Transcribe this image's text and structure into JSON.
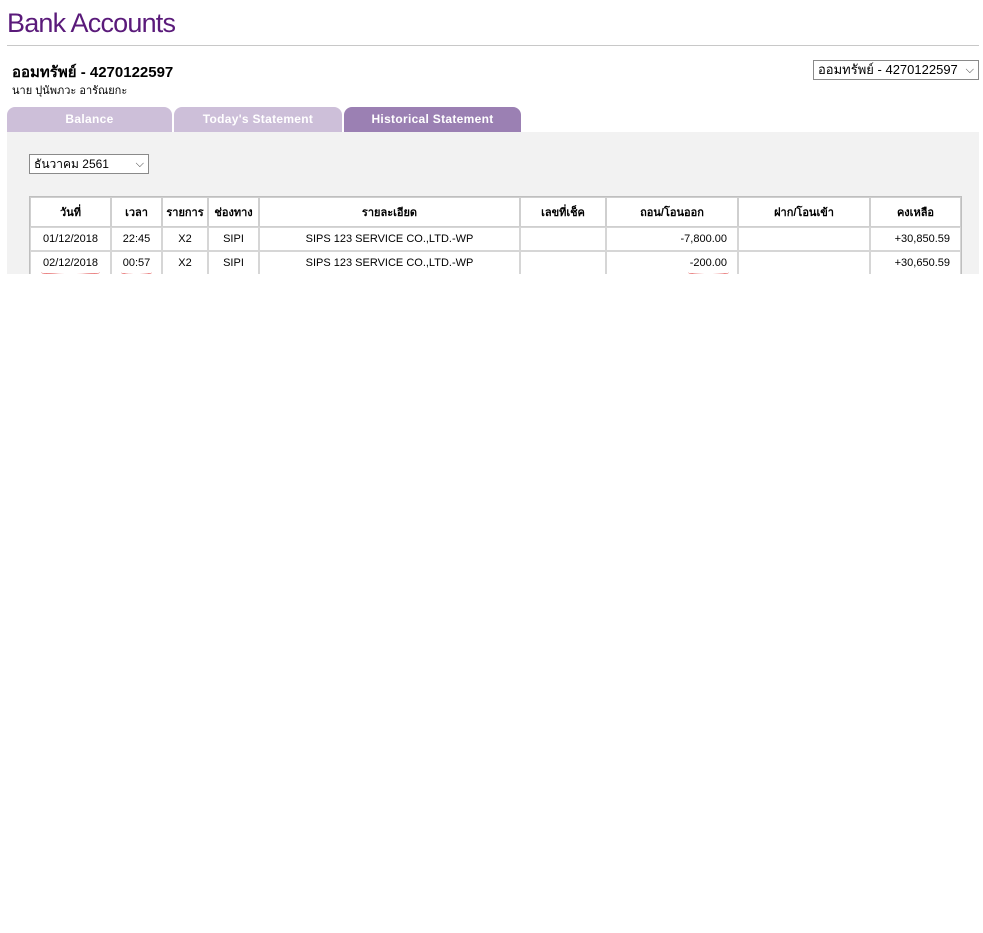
{
  "page": {
    "title": "Bank Accounts"
  },
  "account": {
    "name": "ออมทรัพย์ - 4270122597",
    "owner": "นาย ปุนัพภวะ อารัณยกะ",
    "selector_value": "ออมทรัพย์ - 4270122597"
  },
  "tabs": [
    {
      "label": "Balance"
    },
    {
      "label": "Today's Statement"
    },
    {
      "label": "Historical Statement"
    }
  ],
  "filters": {
    "month_value": "ธันวาคม 2561"
  },
  "statement": {
    "headers": [
      "วันที่",
      "เวลา",
      "รายการ",
      "ช่องทาง",
      "รายละเอียด",
      "เลขที่เช็ค",
      "ถอน/โอนออก",
      "ฝาก/โอนเข้า",
      "คงเหลือ"
    ],
    "rows": [
      {
        "date": "01/12/2018",
        "time": "22:45",
        "code": "X2",
        "channel": "SIPI",
        "detail": "SIPS 123 SERVICE CO.,LTD.-WP",
        "cheque": "",
        "withdraw": "-7,800.00",
        "deposit": "",
        "balance": "+30,850.59"
      },
      {
        "date": "02/12/2018",
        "time": "00:57",
        "code": "X2",
        "channel": "SIPI",
        "detail": "SIPS 123 SERVICE CO.,LTD.-WP",
        "cheque": "",
        "withdraw": "-200.00",
        "deposit": "",
        "balance": "+30,650.59"
      }
    ]
  },
  "colors": {
    "title": "#5a1a7a",
    "tab_active": "#9b80b3",
    "tab_inactive": "#cdbfd9",
    "annotation": "#d81b1b"
  }
}
